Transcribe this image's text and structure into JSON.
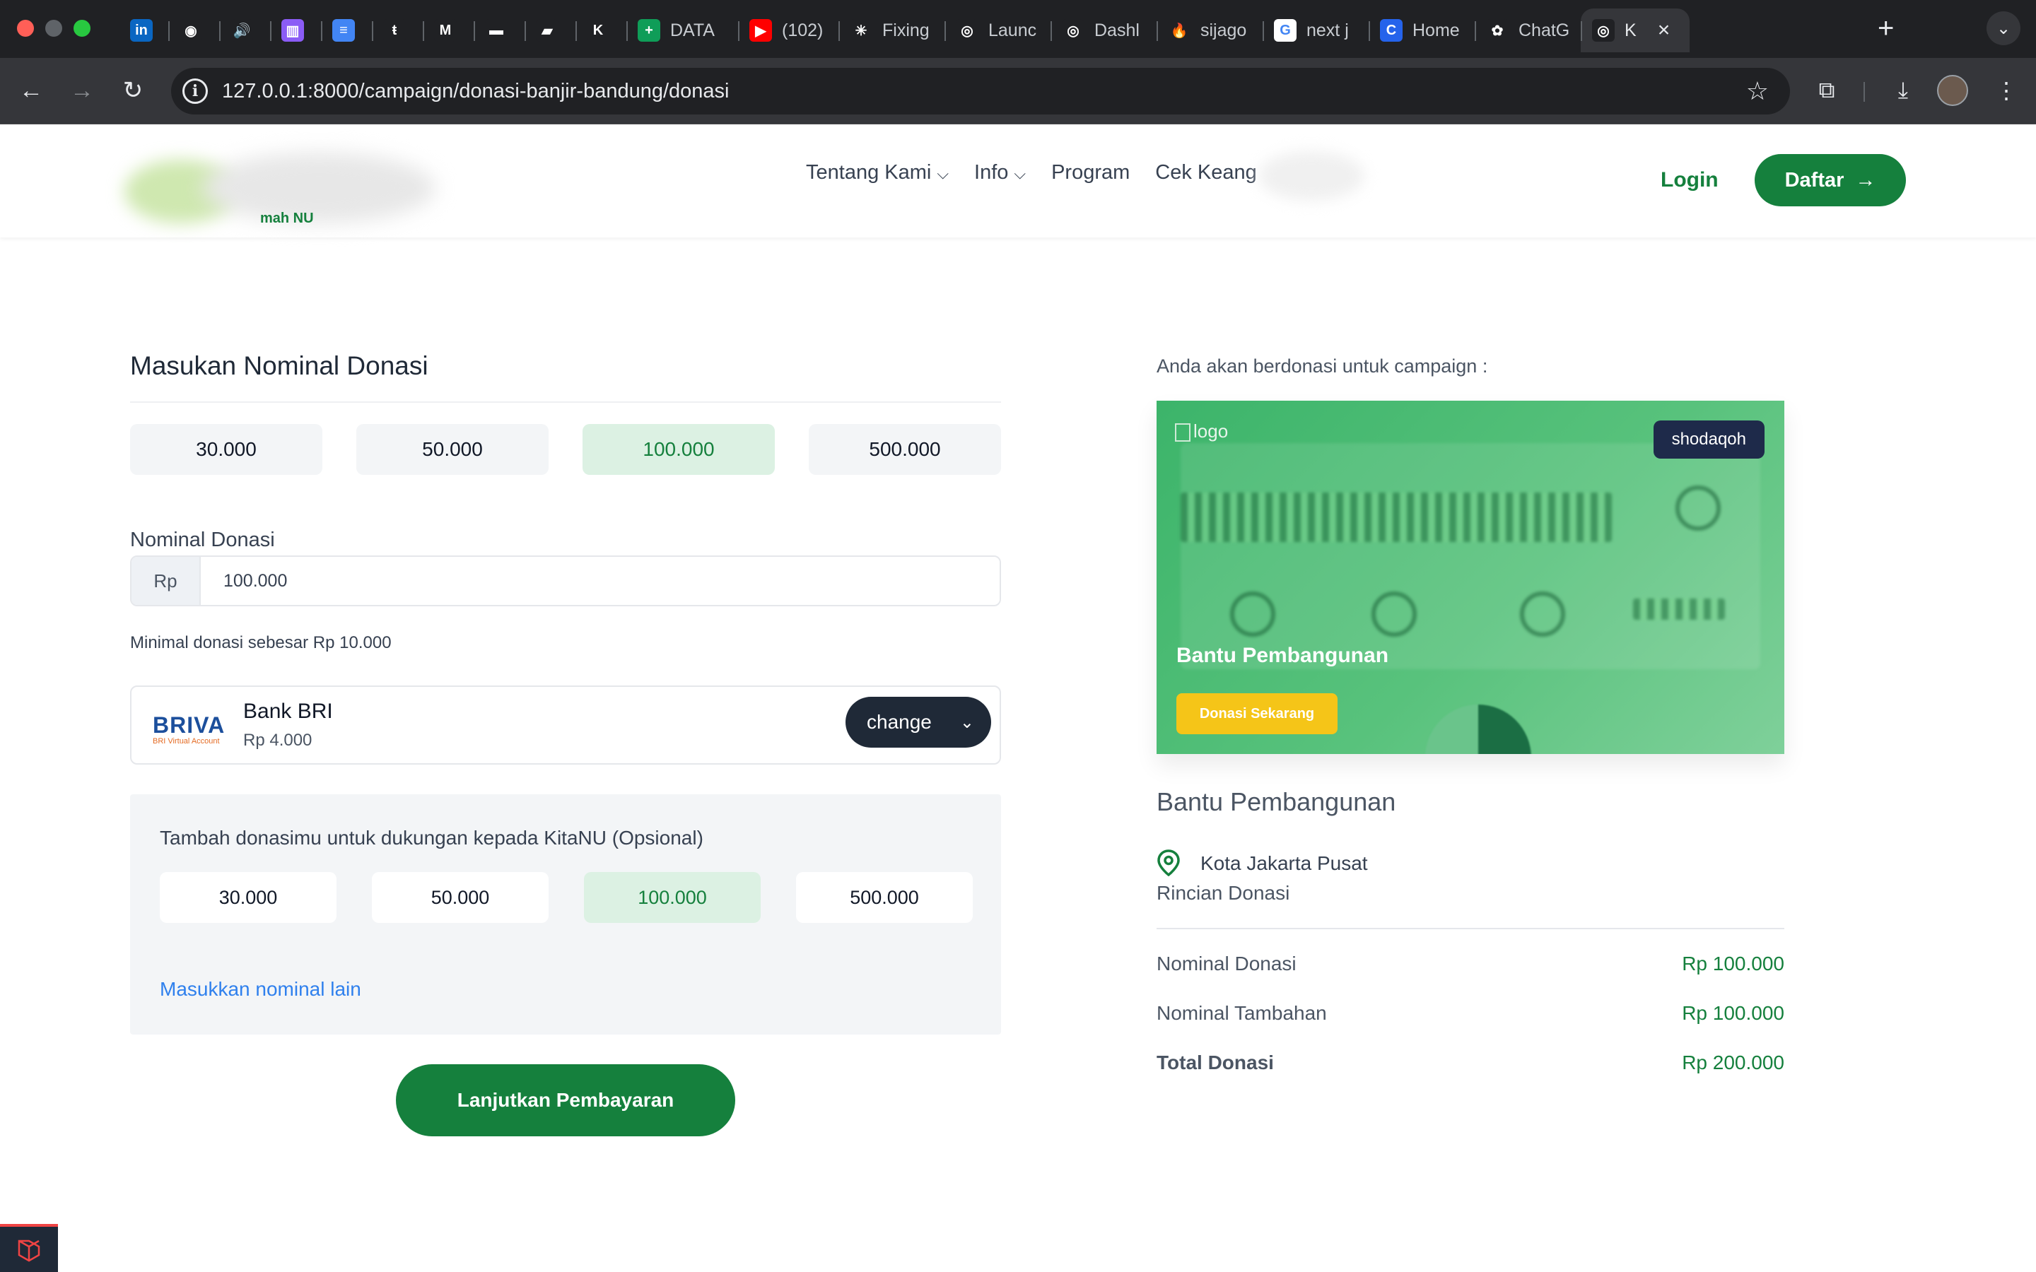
{
  "browser": {
    "tabs": [
      {
        "label": "",
        "icon": "linkedin-icon",
        "color": "#0a66c2",
        "glyph": "in"
      },
      {
        "label": "",
        "icon": "github-icon",
        "color": "#202124",
        "glyph": "◉"
      },
      {
        "label": "",
        "icon": "speaker-icon",
        "color": "#202124",
        "glyph": "🔊"
      },
      {
        "label": "",
        "icon": "trello-icon",
        "color": "#8b5cf6",
        "glyph": "▥"
      },
      {
        "label": "",
        "icon": "docs-icon",
        "color": "#4285f4",
        "glyph": "≡"
      },
      {
        "label": "",
        "icon": "t-icon",
        "color": "#202124",
        "glyph": "ŧ"
      },
      {
        "label": "",
        "icon": "gmail-icon",
        "color": "#202124",
        "glyph": "M"
      },
      {
        "label": "",
        "icon": "toyota-icon",
        "color": "#202124",
        "glyph": "▬"
      },
      {
        "label": "",
        "icon": "flag-icon",
        "color": "#202124",
        "glyph": "▰"
      },
      {
        "label": "",
        "icon": "laravel-icon",
        "color": "#202124",
        "glyph": "K"
      },
      {
        "label": "DATA",
        "icon": "sheets-icon",
        "color": "#0f9d58",
        "glyph": "+"
      },
      {
        "label": "(102)",
        "icon": "youtube-icon",
        "color": "#ff0000",
        "glyph": "▶"
      },
      {
        "label": "Fixing",
        "icon": "claude-icon",
        "color": "#202124",
        "glyph": "✳"
      },
      {
        "label": "Launc",
        "icon": "emblem-icon",
        "color": "#202124",
        "glyph": "◎"
      },
      {
        "label": "Dashl",
        "icon": "emblem-icon",
        "color": "#202124",
        "glyph": "◎"
      },
      {
        "label": "sijago",
        "icon": "fire-icon",
        "color": "#202124",
        "glyph": "🔥"
      },
      {
        "label": "next j",
        "icon": "google-icon",
        "color": "#ffffff",
        "glyph": "G"
      },
      {
        "label": "Home",
        "icon": "canva-icon",
        "color": "#2563eb",
        "glyph": "C"
      },
      {
        "label": "ChatG",
        "icon": "openai-icon",
        "color": "#202124",
        "glyph": "✿"
      },
      {
        "label": "K",
        "icon": "emblem-icon",
        "color": "#202124",
        "glyph": "◎",
        "active": true
      }
    ],
    "url": "127.0.0.1:8000/campaign/donasi-banjir-bandung/donasi"
  },
  "header": {
    "logo_subtitle": "mah NU",
    "nav": [
      {
        "label": "Tentang Kami",
        "has_dropdown": true
      },
      {
        "label": "Info",
        "has_dropdown": true
      },
      {
        "label": "Program",
        "has_dropdown": false
      },
      {
        "label": "Cek Keang",
        "has_dropdown": false
      }
    ],
    "login_label": "Login",
    "register_label": "Daftar"
  },
  "donation_form": {
    "title": "Masukan Nominal Donasi",
    "presets": [
      "30.000",
      "50.000",
      "100.000",
      "500.000"
    ],
    "selected_preset": "100.000",
    "amount_label": "Nominal Donasi",
    "currency_prefix": "Rp",
    "amount_value": "100.000",
    "min_note": "Minimal donasi sebesar Rp 10.000",
    "payment": {
      "logo_text": "BRIVA",
      "logo_subtext": "BRI Virtual Account",
      "bank_name": "Bank BRI",
      "fee": "Rp 4.000",
      "change_label": "change"
    },
    "extra": {
      "title": "Tambah donasimu untuk dukungan kepada KitaNU (Opsional)",
      "presets": [
        "30.000",
        "50.000",
        "100.000",
        "500.000"
      ],
      "selected_preset": "100.000",
      "other_link": "Masukkan nominal lain"
    },
    "submit_label": "Lanjutkan Pembayaran"
  },
  "summary": {
    "intro": "Anda akan berdonasi untuk campaign :",
    "banner": {
      "broken_image_alt": "logo",
      "category_badge": "shodaqoh",
      "title": "Bantu Pembangunan",
      "cta": "Donasi Sekarang"
    },
    "campaign_name": "Bantu Pembangunan",
    "location": "Kota Jakarta Pusat",
    "details_heading": "Rincian Donasi",
    "rows": [
      {
        "label": "Nominal Donasi",
        "value": "Rp 100.000"
      },
      {
        "label": "Nominal Tambahan",
        "value": "Rp 100.000"
      },
      {
        "label": "Total Donasi",
        "value": "Rp 200.000"
      }
    ]
  },
  "colors": {
    "brand_green": "#15803d",
    "selected_bg": "#dcf1e3",
    "link_blue": "#2f80ed",
    "badge_navy": "#1e2a4a",
    "cta_yellow": "#f5c518"
  }
}
